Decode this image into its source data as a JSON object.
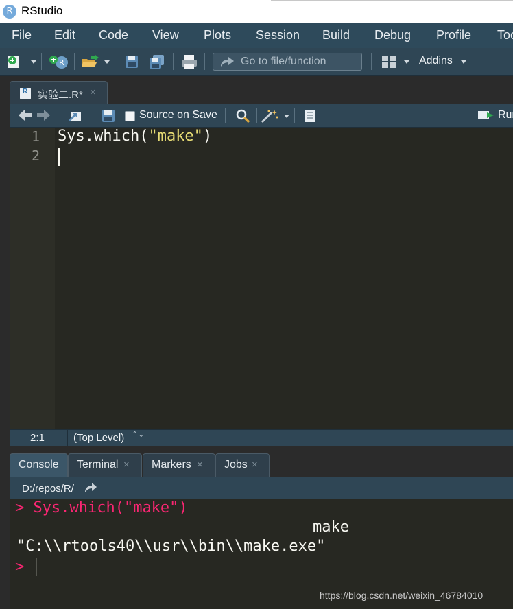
{
  "window": {
    "title": "RStudio",
    "logo_letter": "R"
  },
  "menu": [
    "File",
    "Edit",
    "Code",
    "View",
    "Plots",
    "Session",
    "Build",
    "Debug",
    "Profile",
    "Tools"
  ],
  "toolbar": {
    "goto_placeholder": "Go to file/function",
    "addins_label": "Addins"
  },
  "editor": {
    "tab": {
      "file_letter": "R",
      "label": "实验二.R*",
      "close_glyph": "×"
    },
    "toolbar": {
      "source_on_save": "Source on Save",
      "run_label": "Run"
    },
    "line_numbers": [
      "1",
      "2"
    ],
    "code": {
      "prefix": "Sys.which(",
      "string": "\"make\"",
      "suffix": ")"
    },
    "status": {
      "cursor_position": "2:1",
      "scope": "(Top Level)",
      "scope_arrows": "⌃⌄"
    }
  },
  "console": {
    "tabs": [
      {
        "label": "Console",
        "active": true
      },
      {
        "label": "Terminal",
        "close": "×"
      },
      {
        "label": "Markers",
        "close": "×"
      },
      {
        "label": "Jobs",
        "close": "×"
      }
    ],
    "path": "D:/repos/R/",
    "prompt": ">",
    "command": "Sys.which(\"make\")",
    "output_name": "make",
    "output_value": "\"C:\\\\rtools40\\\\usr\\\\bin\\\\make.exe\""
  },
  "watermark": "https://blog.csdn.net/weixin_46784010",
  "colors": {
    "menu_bg": "#2e4a5b",
    "editor_bg": "#272822",
    "string": "#e6db74",
    "prompt": "#f92672"
  }
}
